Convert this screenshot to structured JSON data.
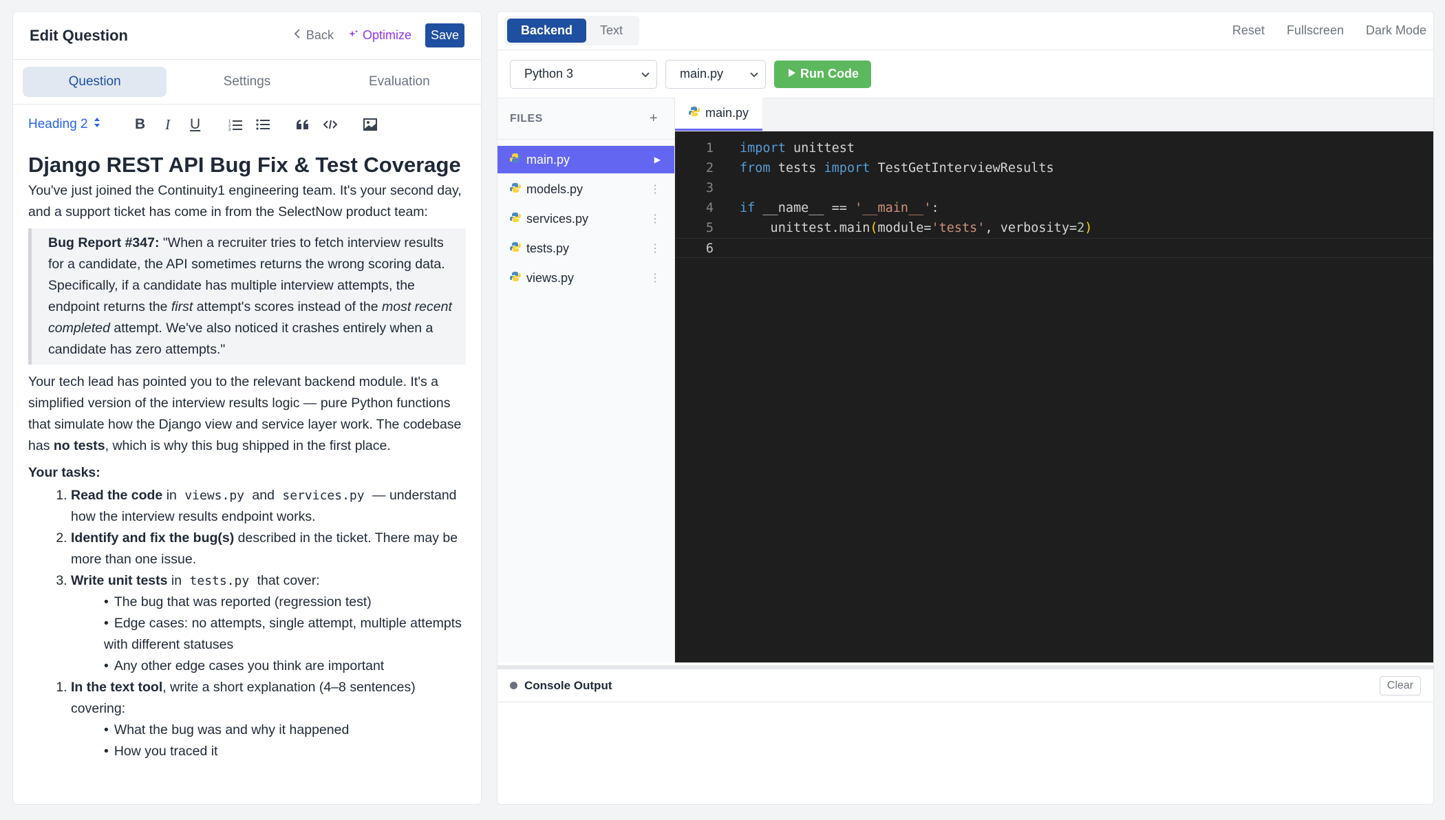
{
  "left": {
    "title": "Edit Question",
    "back_label": "Back",
    "optimize_label": "Optimize",
    "save_label": "Save",
    "tabs": [
      "Question",
      "Settings",
      "Evaluation"
    ],
    "heading_select": "Heading 2",
    "content": {
      "heading": "Django REST API Bug Fix & Test Coverage",
      "intro": "You've just joined the Continuity1 engineering team. It's your second day, and a support ticket has come in from the SelectNow product team:",
      "bug_label": "Bug Report #347:",
      "bug_part1": " \"When a recruiter tries to fetch interview results for a candidate, the API sometimes returns the wrong scoring data. Specifically, if a candidate has multiple interview attempts, the endpoint returns the ",
      "bug_em1": "first",
      "bug_part2": " attempt's scores instead of the ",
      "bug_em2": "most recent completed",
      "bug_part3": " attempt. We've also noticed it crashes entirely when a candidate has zero attempts.\"",
      "para2_part1": "Your tech lead has pointed you to the relevant backend module. It's a simplified version of the interview results logic — pure Python functions that simulate how the Django view and service layer work. The codebase has ",
      "para2_bold": "no tests",
      "para2_part2": ", which is why this bug shipped in the first place.",
      "tasks_heading": "Your tasks:",
      "task1_bold": "Read the code",
      "task1_in": " in ",
      "task1_code1": "views.py",
      "task1_and": " and ",
      "task1_code2": "services.py",
      "task1_rest": " — understand how the interview results endpoint works.",
      "task2_bold": "Identify and fix the bug(s)",
      "task2_rest": " described in the ticket. There may be more than one issue.",
      "task3_bold": "Write unit tests",
      "task3_in": " in ",
      "task3_code": "tests.py",
      "task3_rest": " that cover:",
      "task3_subs": [
        "The bug that was reported (regression test)",
        "Edge cases: no attempts, single attempt, multiple attempts with different statuses",
        "Any other edge cases you think are important"
      ],
      "task4_bold": "In the text tool",
      "task4_rest": ", write a short explanation (4–8 sentences) covering:",
      "task4_subs": [
        "What the bug was and why it happened",
        "How you traced it"
      ]
    }
  },
  "right": {
    "mode_tabs": [
      "Backend",
      "Text"
    ],
    "top_links": [
      "Reset",
      "Fullscreen",
      "Dark Mode"
    ],
    "language_select": "Python 3",
    "file_select": "main.py",
    "run_label": "Run Code",
    "files_heading": "FILES",
    "files": [
      "main.py",
      "models.py",
      "services.py",
      "tests.py",
      "views.py"
    ],
    "active_tab": "main.py",
    "line_numbers": [
      "1",
      "2",
      "3",
      "4",
      "5",
      "6"
    ],
    "code": {
      "l1_kw": "import",
      "l1_rest": " unittest",
      "l2_kw1": "from",
      "l2_mid": " tests ",
      "l2_kw2": "import",
      "l2_rest": " TestGetInterviewResults",
      "l4_kw": "if",
      "l4_mid": " __name__ == ",
      "l4_str": "'__main__'",
      "l4_end": ":",
      "l5_pre": "    unittest.main",
      "l5_open": "(",
      "l5_arg1": "module=",
      "l5_str": "'tests'",
      "l5_arg2": ", verbosity=",
      "l5_num": "2",
      "l5_close": ")"
    },
    "console_title": "Console Output",
    "clear_label": "Clear"
  }
}
